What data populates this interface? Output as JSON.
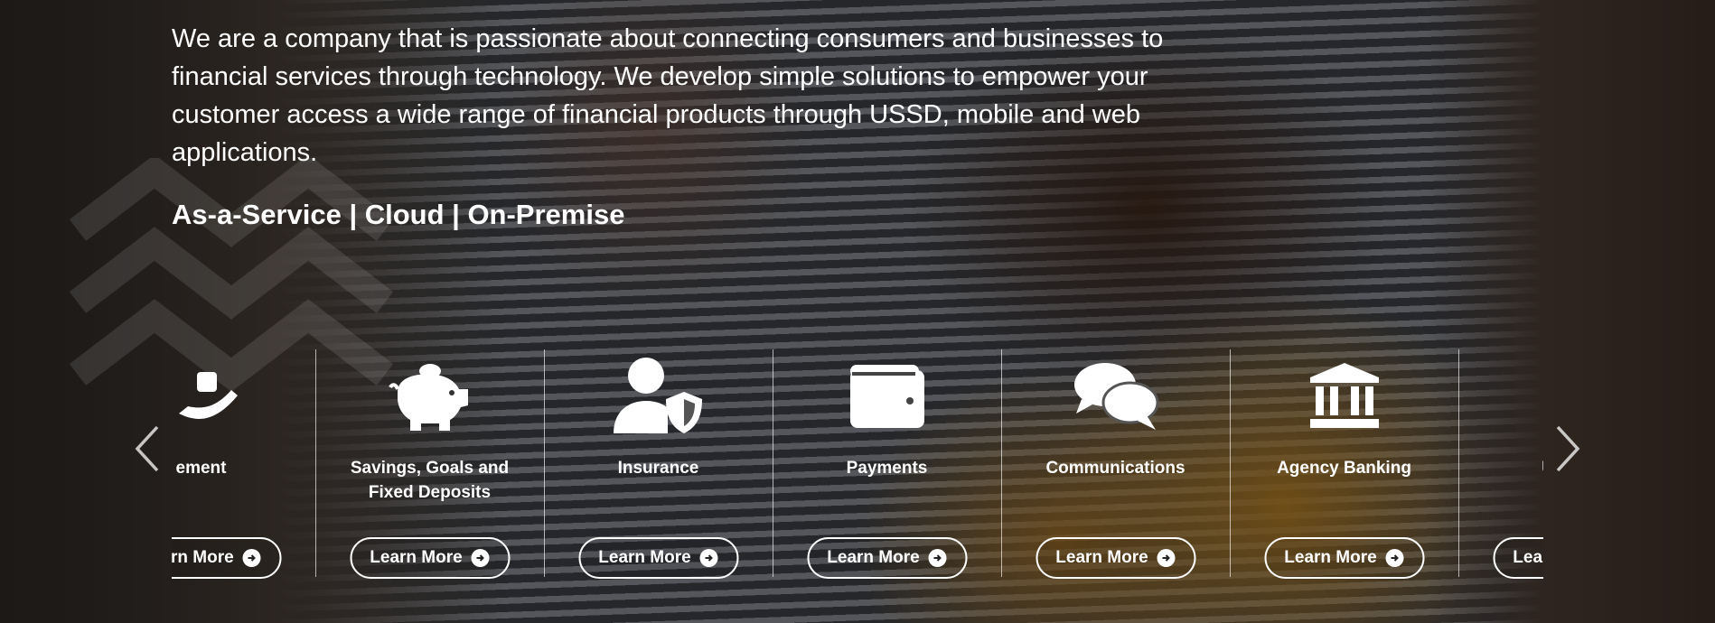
{
  "intro": {
    "paragraph": "We are a company that is passionate about connecting consumers and businesses to financial services through technology. We develop simple solutions to empower your customer access a wide range of financial products through USSD, mobile and web applications.",
    "tagline": "As-a-Service | Cloud | On-Premise"
  },
  "carousel": {
    "prev_icon": "chevron-left-icon",
    "next_icon": "chevron-right-icon",
    "cards": [
      {
        "title": "ement",
        "icon": "wealth-management-icon",
        "button": "Learn More"
      },
      {
        "title": "Savings, Goals and Fixed Deposits",
        "icon": "piggy-bank-icon",
        "button": "Learn More"
      },
      {
        "title": "Insurance",
        "icon": "user-shield-icon",
        "button": "Learn More"
      },
      {
        "title": "Payments",
        "icon": "wallet-icon",
        "button": "Learn More"
      },
      {
        "title": "Communications",
        "icon": "chat-bubbles-icon",
        "button": "Learn More"
      },
      {
        "title": "Agency Banking",
        "icon": "bank-building-icon",
        "button": "Learn More"
      },
      {
        "title": "Utilities",
        "icon": "plug-icon",
        "button": "Learn More"
      }
    ]
  },
  "colors": {
    "text": "#ffffff",
    "overlay": "#0a0a0c"
  }
}
